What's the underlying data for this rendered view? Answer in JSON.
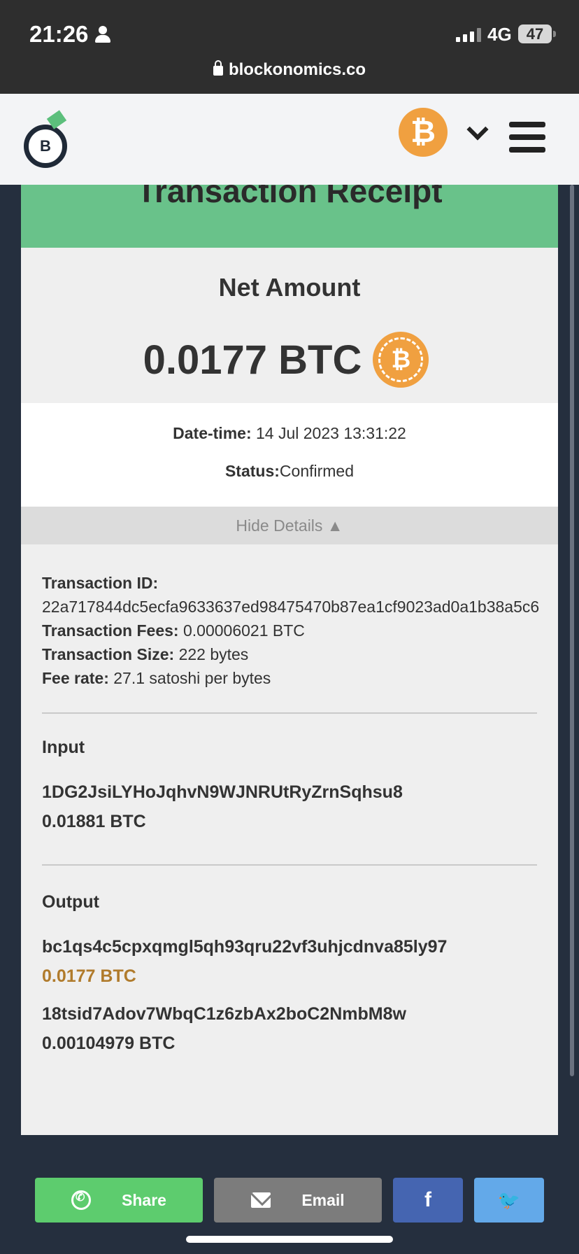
{
  "status_bar": {
    "time": "21:26",
    "network": "4G",
    "battery": "47",
    "url": "blockonomics.co"
  },
  "header": {
    "logo_letter": "B",
    "currency_symbol": "₿",
    "icons": [
      "lock-icon",
      "person-icon",
      "bitcoin-icon",
      "chevron-down-icon",
      "menu-icon"
    ]
  },
  "receipt": {
    "title": "Transaction Receipt",
    "net_label": "Net Amount",
    "net_amount": "0.0177 BTC",
    "coin_symbol": "₿",
    "datetime_label": "Date-time:",
    "datetime_value": "14 Jul 2023 13:31:22",
    "status_label": "Status:",
    "status_value": "Confirmed",
    "hide_details": "Hide Details ▲"
  },
  "details": {
    "tx_id_label": "Transaction ID:",
    "tx_id_value": "22a717844dc5ecfa9633637ed98475470b87ea1cf9023ad0a1b38a5c6",
    "fees_label": "Transaction Fees:",
    "fees_value": "0.00006021 BTC",
    "size_label": "Transaction Size:",
    "size_value": "222 bytes",
    "feerate_label": "Fee rate:",
    "feerate_value": "27.1 satoshi per bytes"
  },
  "input": {
    "title": "Input",
    "address": "1DG2JsiLYHoJqhvN9WJNRUtRyZrnSqhsu8",
    "amount": "0.01881 BTC"
  },
  "output": {
    "title": "Output",
    "items": [
      {
        "address": "bc1qs4c5cpxqmgl5qh93qru22vf3uhjcdnva85ly97",
        "amount": "0.0177 BTC"
      },
      {
        "address": "18tsid7Adov7WbqC1z6zbAx2boC2NmbM8w",
        "amount": "0.00104979 BTC"
      }
    ]
  },
  "share": {
    "whatsapp_label": "Share",
    "email_label": "Email",
    "facebook_glyph": "f",
    "twitter_glyph": "🐦"
  },
  "colors": {
    "banner_green": "#69c28a",
    "accent_amount": "#b07b2c",
    "bitcoin_orange": "#f0a040"
  }
}
